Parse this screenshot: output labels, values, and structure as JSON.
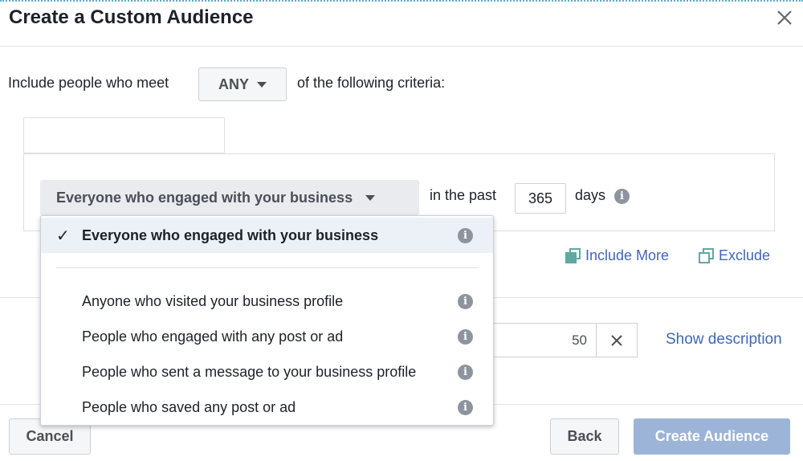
{
  "dialog": {
    "title": "Create a Custom Audience"
  },
  "criteria": {
    "prefix": "Include people who meet",
    "match_value": "ANY",
    "suffix": "of the following criteria:"
  },
  "rule": {
    "source_value": "Everyone who engaged with your business",
    "in_the_past": "in the past",
    "days_value": "365",
    "days_label": "days"
  },
  "links": {
    "include_more": "Include More",
    "exclude": "Exclude"
  },
  "dropdown": {
    "options": [
      {
        "label": "Everyone who engaged with your business",
        "selected": true
      },
      {
        "label": "Anyone who visited your business profile",
        "selected": false
      },
      {
        "label": "People who engaged with any post or ad",
        "selected": false
      },
      {
        "label": "People who sent a message to your business profile",
        "selected": false
      },
      {
        "label": "People who saved any post or ad",
        "selected": false
      }
    ]
  },
  "audience": {
    "char_count": "50",
    "show_description": "Show description"
  },
  "footer": {
    "cancel": "Cancel",
    "back": "Back",
    "create": "Create Audience"
  },
  "colors": {
    "link": "#4267b2",
    "primary_disabled": "#9cb4d8",
    "icon_teal": "#5fa9a2"
  }
}
